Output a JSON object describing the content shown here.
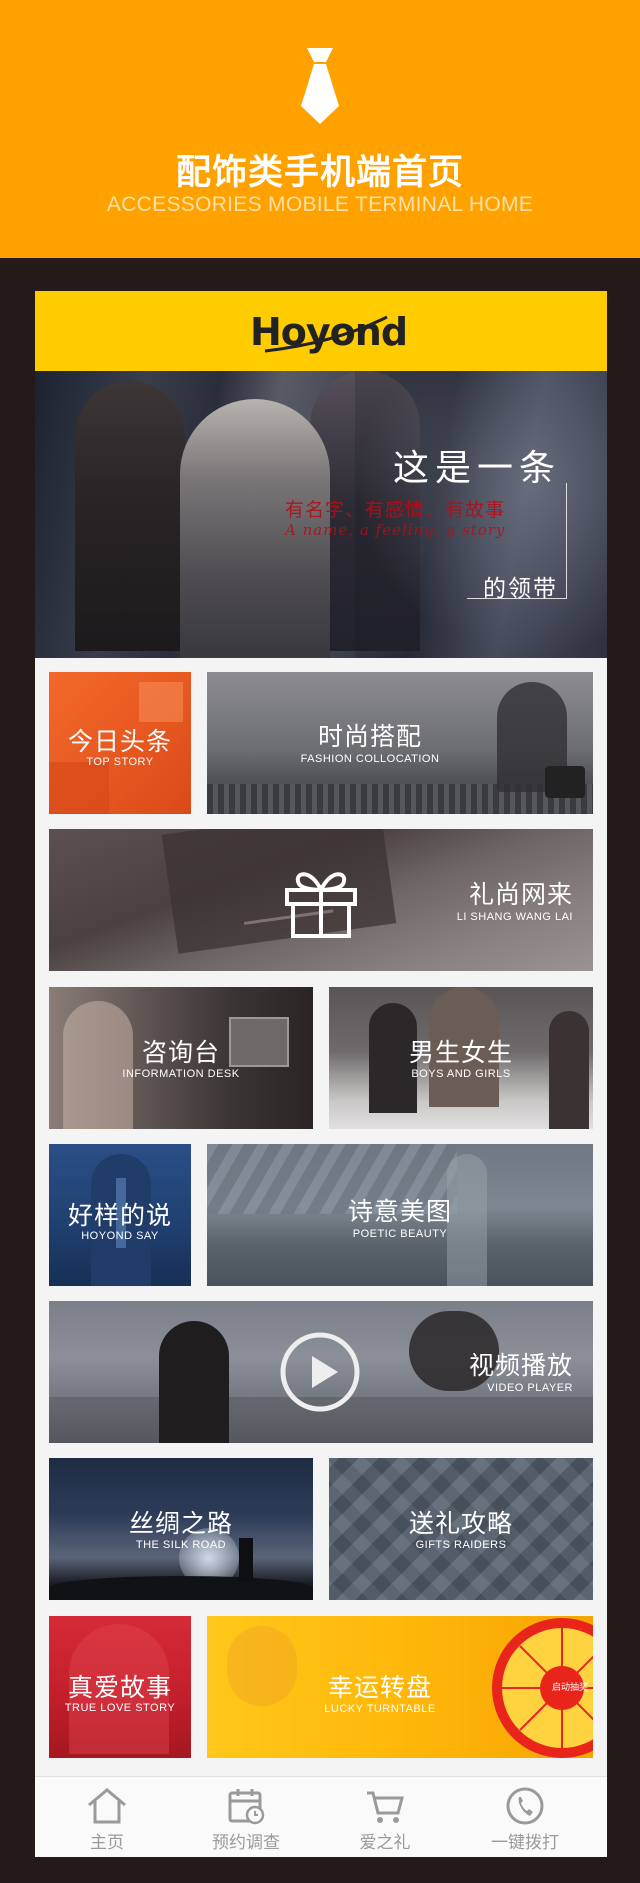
{
  "banner": {
    "title": "配饰类手机端首页",
    "subtitle": "ACCESSORIES MOBILE TERMINAL HOME",
    "icon": "tie-icon"
  },
  "header": {
    "logo_text": "Hoyond"
  },
  "hero": {
    "line1": "这是一条",
    "line2": "有名字、有感情、有故事",
    "line3": "A name, a feeling, a story",
    "line4": "的领带"
  },
  "tiles": [
    {
      "zh": "今日头条",
      "en": "TOP STORY"
    },
    {
      "zh": "时尚搭配",
      "en": "FASHION COLLOCATION"
    },
    {
      "zh": "礼尚网来",
      "en": "LI SHANG WANG LAI"
    },
    {
      "zh": "咨询台",
      "en": "INFORMATION DESK"
    },
    {
      "zh": "男生女生",
      "en": "BOYS AND GIRLS"
    },
    {
      "zh": "好样的说",
      "en": "HOYOND SAY"
    },
    {
      "zh": "诗意美图",
      "en": "POETIC BEAUTY"
    },
    {
      "zh": "视频播放",
      "en": "VIDEO PLAYER"
    },
    {
      "zh": "丝绸之路",
      "en": "THE SILK ROAD"
    },
    {
      "zh": "送礼攻略",
      "en": "GIFTS RAIDERS"
    },
    {
      "zh": "真爱故事",
      "en": "TRUE LOVE STORY"
    },
    {
      "zh": "幸运转盘",
      "en": "LUCKY TURNTABLE",
      "wheel_label": "启动抽奖"
    }
  ],
  "tabbar": [
    {
      "label": "主页",
      "icon": "home-icon"
    },
    {
      "label": "预约调查",
      "icon": "calendar-clock-icon"
    },
    {
      "label": "爱之礼",
      "icon": "cart-icon"
    },
    {
      "label": "一键拨打",
      "icon": "phone-icon"
    }
  ],
  "colors": {
    "banner_bg": "#ffa200",
    "header_bg": "#ffcc00",
    "page_bg": "#241b19",
    "tile_orange": "#e65a24",
    "tile_red": "#c91f2b",
    "tile_yellow": "#ffb400"
  }
}
